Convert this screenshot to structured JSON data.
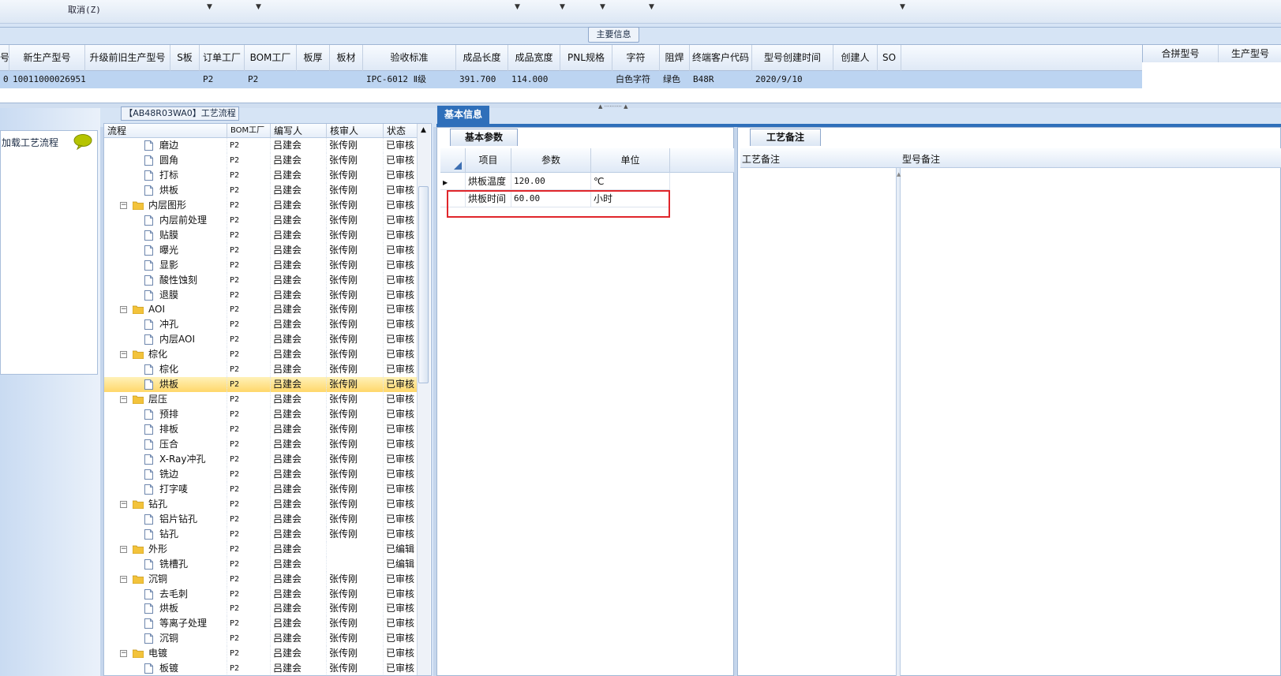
{
  "toolbar": {
    "cancel_label": "取消(Z)"
  },
  "main_info": {
    "title": "主要信息",
    "columns": [
      "号",
      "新生产型号",
      "升级前旧生产型号",
      "S板",
      "订单工厂",
      "BOM工厂",
      "板厚",
      "板材",
      "验收标准",
      "成品长度",
      "成品宽度",
      "PNL规格",
      "字符",
      "阻焊",
      "终端客户代码",
      "型号创建时间",
      "创建人",
      "SO"
    ],
    "row": [
      "0",
      "10011000026951",
      "",
      "",
      "P2",
      "P2",
      "",
      "",
      "IPC-6012 Ⅱ级",
      "391.700",
      "114.000",
      "",
      "白色字符",
      "绿色",
      "B48R",
      "2020/9/10",
      "",
      ""
    ],
    "right_columns": [
      "合拼型号",
      "生产型号"
    ]
  },
  "left_pane": {
    "load_flow_label": "加载工艺流程"
  },
  "process_tree": {
    "title": "【AB48R03WA0】工艺流程",
    "columns": [
      "流程",
      "BOM工厂",
      "编写人",
      "核审人",
      "状态"
    ],
    "rows": [
      {
        "name": "磨边",
        "level": 2,
        "type": "doc",
        "bom": "P2",
        "writer": "吕建会",
        "reviewer": "张传刚",
        "status": "已审核"
      },
      {
        "name": "圆角",
        "level": 2,
        "type": "doc",
        "bom": "P2",
        "writer": "吕建会",
        "reviewer": "张传刚",
        "status": "已审核"
      },
      {
        "name": "打标",
        "level": 2,
        "type": "doc",
        "bom": "P2",
        "writer": "吕建会",
        "reviewer": "张传刚",
        "status": "已审核"
      },
      {
        "name": "烘板",
        "level": 2,
        "type": "doc",
        "bom": "P2",
        "writer": "吕建会",
        "reviewer": "张传刚",
        "status": "已审核"
      },
      {
        "name": "内层图形",
        "level": 1,
        "type": "folder",
        "bom": "P2",
        "writer": "吕建会",
        "reviewer": "张传刚",
        "status": "已审核"
      },
      {
        "name": "内层前处理",
        "level": 2,
        "type": "doc",
        "bom": "P2",
        "writer": "吕建会",
        "reviewer": "张传刚",
        "status": "已审核"
      },
      {
        "name": "贴膜",
        "level": 2,
        "type": "doc",
        "bom": "P2",
        "writer": "吕建会",
        "reviewer": "张传刚",
        "status": "已审核"
      },
      {
        "name": "曝光",
        "level": 2,
        "type": "doc",
        "bom": "P2",
        "writer": "吕建会",
        "reviewer": "张传刚",
        "status": "已审核"
      },
      {
        "name": "显影",
        "level": 2,
        "type": "doc",
        "bom": "P2",
        "writer": "吕建会",
        "reviewer": "张传刚",
        "status": "已审核"
      },
      {
        "name": "酸性蚀刻",
        "level": 2,
        "type": "doc",
        "bom": "P2",
        "writer": "吕建会",
        "reviewer": "张传刚",
        "status": "已审核"
      },
      {
        "name": "退膜",
        "level": 2,
        "type": "doc",
        "bom": "P2",
        "writer": "吕建会",
        "reviewer": "张传刚",
        "status": "已审核"
      },
      {
        "name": "AOI",
        "level": 1,
        "type": "folder",
        "bom": "P2",
        "writer": "吕建会",
        "reviewer": "张传刚",
        "status": "已审核"
      },
      {
        "name": "冲孔",
        "level": 2,
        "type": "doc",
        "bom": "P2",
        "writer": "吕建会",
        "reviewer": "张传刚",
        "status": "已审核"
      },
      {
        "name": "内层AOI",
        "level": 2,
        "type": "doc",
        "bom": "P2",
        "writer": "吕建会",
        "reviewer": "张传刚",
        "status": "已审核"
      },
      {
        "name": "棕化",
        "level": 1,
        "type": "folder",
        "bom": "P2",
        "writer": "吕建会",
        "reviewer": "张传刚",
        "status": "已审核"
      },
      {
        "name": "棕化",
        "level": 2,
        "type": "doc",
        "bom": "P2",
        "writer": "吕建会",
        "reviewer": "张传刚",
        "status": "已审核"
      },
      {
        "name": "烘板",
        "level": 2,
        "type": "doc",
        "bom": "P2",
        "writer": "吕建会",
        "reviewer": "张传刚",
        "status": "已审核",
        "selected": true
      },
      {
        "name": "层压",
        "level": 1,
        "type": "folder",
        "bom": "P2",
        "writer": "吕建会",
        "reviewer": "张传刚",
        "status": "已审核"
      },
      {
        "name": "预排",
        "level": 2,
        "type": "doc",
        "bom": "P2",
        "writer": "吕建会",
        "reviewer": "张传刚",
        "status": "已审核"
      },
      {
        "name": "排板",
        "level": 2,
        "type": "doc",
        "bom": "P2",
        "writer": "吕建会",
        "reviewer": "张传刚",
        "status": "已审核"
      },
      {
        "name": "压合",
        "level": 2,
        "type": "doc",
        "bom": "P2",
        "writer": "吕建会",
        "reviewer": "张传刚",
        "status": "已审核"
      },
      {
        "name": "X-Ray冲孔",
        "level": 2,
        "type": "doc",
        "bom": "P2",
        "writer": "吕建会",
        "reviewer": "张传刚",
        "status": "已审核"
      },
      {
        "name": "铣边",
        "level": 2,
        "type": "doc",
        "bom": "P2",
        "writer": "吕建会",
        "reviewer": "张传刚",
        "status": "已审核"
      },
      {
        "name": "打字唛",
        "level": 2,
        "type": "doc",
        "bom": "P2",
        "writer": "吕建会",
        "reviewer": "张传刚",
        "status": "已审核"
      },
      {
        "name": "钻孔",
        "level": 1,
        "type": "folder",
        "bom": "P2",
        "writer": "吕建会",
        "reviewer": "张传刚",
        "status": "已审核"
      },
      {
        "name": "铝片钻孔",
        "level": 2,
        "type": "doc",
        "bom": "P2",
        "writer": "吕建会",
        "reviewer": "张传刚",
        "status": "已审核"
      },
      {
        "name": "钻孔",
        "level": 2,
        "type": "doc",
        "bom": "P2",
        "writer": "吕建会",
        "reviewer": "张传刚",
        "status": "已审核"
      },
      {
        "name": "外形",
        "level": 1,
        "type": "folder",
        "bom": "P2",
        "writer": "吕建会",
        "reviewer": "",
        "status": "已编辑"
      },
      {
        "name": "铣槽孔",
        "level": 2,
        "type": "doc",
        "bom": "P2",
        "writer": "吕建会",
        "reviewer": "",
        "status": "已编辑"
      },
      {
        "name": "沉铜",
        "level": 1,
        "type": "folder",
        "bom": "P2",
        "writer": "吕建会",
        "reviewer": "张传刚",
        "status": "已审核"
      },
      {
        "name": "去毛刺",
        "level": 2,
        "type": "doc",
        "bom": "P2",
        "writer": "吕建会",
        "reviewer": "张传刚",
        "status": "已审核"
      },
      {
        "name": "烘板",
        "level": 2,
        "type": "doc",
        "bom": "P2",
        "writer": "吕建会",
        "reviewer": "张传刚",
        "status": "已审核"
      },
      {
        "name": "等离子处理",
        "level": 2,
        "type": "doc",
        "bom": "P2",
        "writer": "吕建会",
        "reviewer": "张传刚",
        "status": "已审核"
      },
      {
        "name": "沉铜",
        "level": 2,
        "type": "doc",
        "bom": "P2",
        "writer": "吕建会",
        "reviewer": "张传刚",
        "status": "已审核"
      },
      {
        "name": "电镀",
        "level": 1,
        "type": "folder",
        "bom": "P2",
        "writer": "吕建会",
        "reviewer": "张传刚",
        "status": "已审核"
      },
      {
        "name": "板镀",
        "level": 2,
        "type": "doc",
        "bom": "P2",
        "writer": "吕建会",
        "reviewer": "张传刚",
        "status": "已审核"
      }
    ]
  },
  "basic_info": {
    "tab_label": "基本信息",
    "param_tab_label": "基本参数",
    "columns": [
      "项目",
      "参数",
      "单位"
    ],
    "rows": [
      {
        "item": "烘板温度",
        "value": "120.00",
        "unit": "℃"
      },
      {
        "item": "烘板时间",
        "value": "60.00",
        "unit": "小时"
      }
    ]
  },
  "remarks": {
    "tab_label": "工艺备注",
    "col1": "工艺备注",
    "col2": "型号备注"
  },
  "colors": {
    "accent": "#2f6fba",
    "selection": "#bcd4f1",
    "tree_selected": "#ffd76a",
    "highlight": "#e0262b"
  }
}
